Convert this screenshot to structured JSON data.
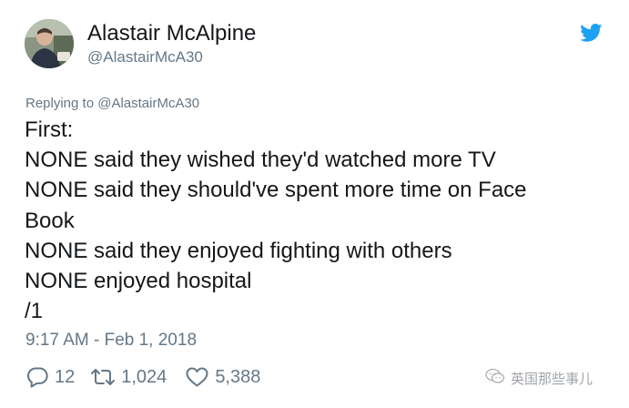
{
  "author": {
    "display_name": "Alastair McAlpine",
    "handle": "@AlastairMcA30"
  },
  "reply_context": "Replying to @AlastairMcA30",
  "tweet": {
    "lines": [
      "First:",
      "NONE said they wished they'd watched more TV",
      "NONE said they should've spent more time on Face",
      "Book",
      "NONE said they enjoyed fighting with others",
      "NONE enjoyed hospital",
      "/1"
    ],
    "timestamp": "9:17 AM - Feb 1, 2018"
  },
  "actions": {
    "replies": "12",
    "retweets": "1,024",
    "likes": "5,388"
  },
  "watermark": "英国那些事儿",
  "icons": {
    "brand": "twitter-bird-icon",
    "reply": "reply-bubble-icon",
    "retweet": "retweet-icon",
    "like": "heart-icon",
    "watermark": "wechat-icon"
  },
  "colors": {
    "brand": "#1da1f2",
    "text": "#14171a",
    "secondary": "#657786"
  }
}
